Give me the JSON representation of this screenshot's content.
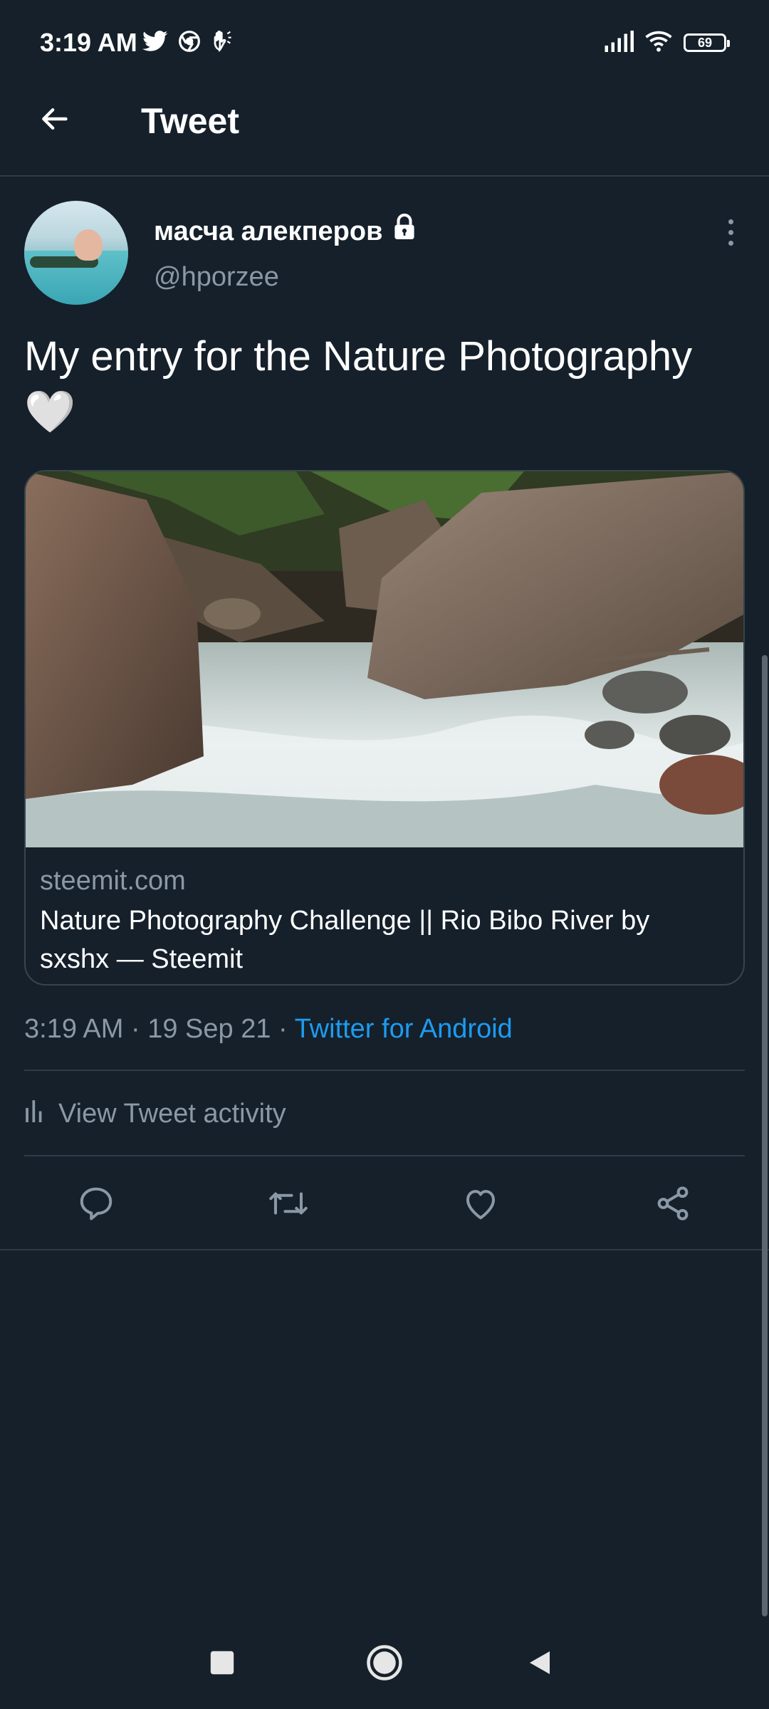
{
  "status_bar": {
    "time": "3:19 AM",
    "battery": "69",
    "icons": [
      "twitter-icon",
      "chrome-icon",
      "hand-icon",
      "signal-icon",
      "wifi-icon",
      "battery-icon"
    ]
  },
  "header": {
    "title": "Tweet",
    "back_icon": "arrow-left-icon"
  },
  "author": {
    "name": "масча алекперов",
    "handle": "@hporzee",
    "locked_icon": "lock-icon"
  },
  "tweet": {
    "text": "My entry for the Nature Photography",
    "emoji": "🤍"
  },
  "card": {
    "domain": "steemit.com",
    "title": "Nature Photography Challenge || Rio Bibo River by sxshx — Steemit"
  },
  "meta": {
    "time": "3:19 AM",
    "date": "19 Sep 21",
    "separator": "·",
    "source": "Twitter for Android"
  },
  "activity": {
    "label": "View Tweet activity"
  },
  "actions": [
    "reply-icon",
    "retweet-icon",
    "like-icon",
    "share-icon"
  ],
  "colors": {
    "background": "#15202b",
    "accent": "#1d9bf0",
    "secondary_text": "#8b98a5",
    "divider": "#2f3b46"
  }
}
